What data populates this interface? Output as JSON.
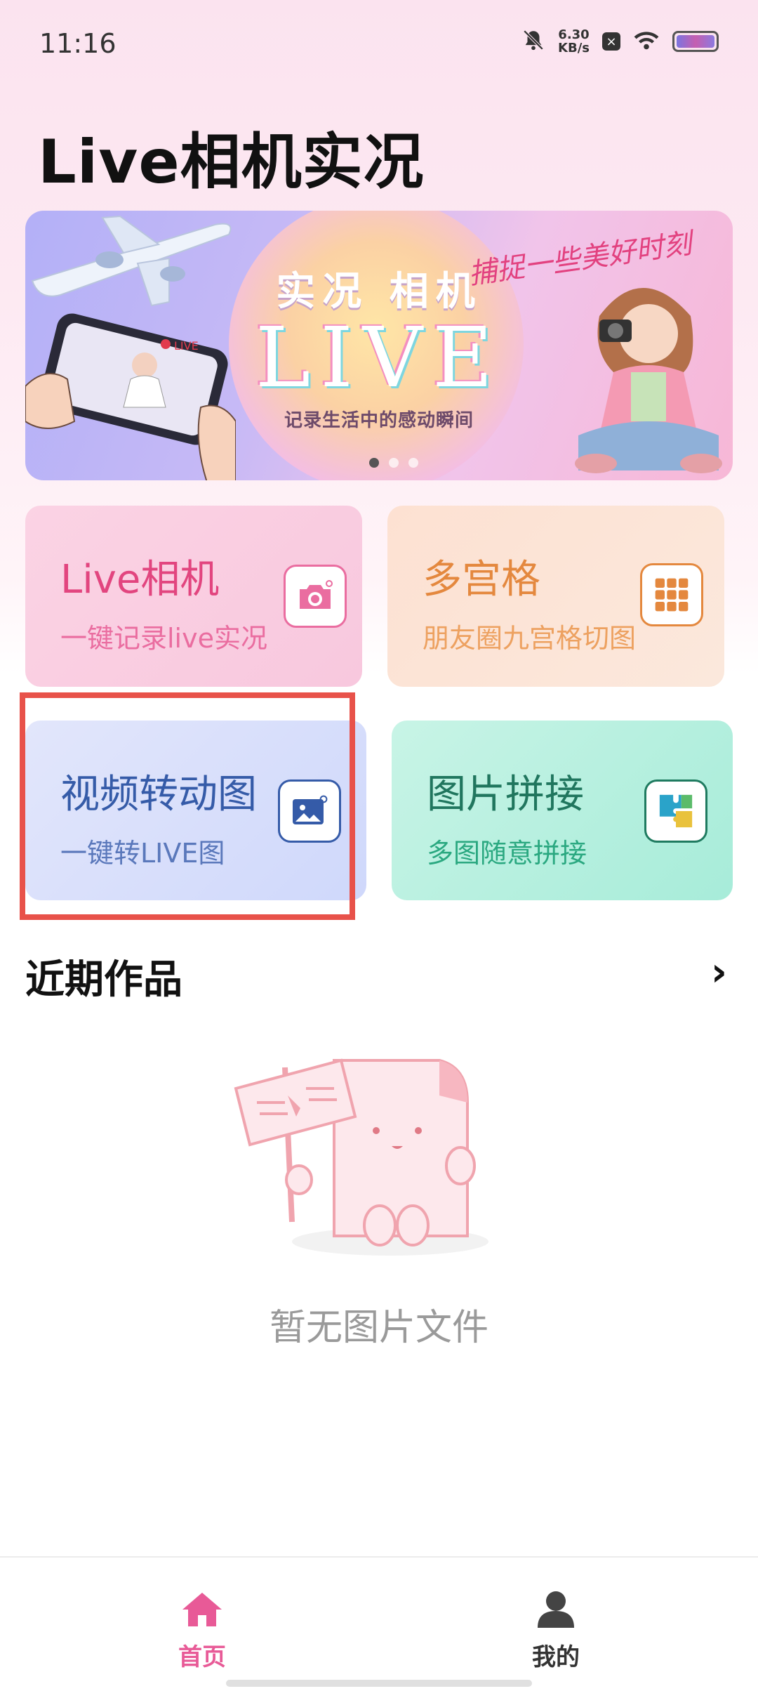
{
  "status_bar": {
    "time": "11:16",
    "net_speed_value": "6.30",
    "net_speed_unit": "KB/s",
    "icons": [
      "mute-bell-icon",
      "close-box-icon",
      "wifi-icon",
      "battery-icon"
    ]
  },
  "header": {
    "title": "Live相机实况"
  },
  "banner": {
    "headline": "实况 相机",
    "big_text": "LIVE",
    "tagline": "记录生活中的感动瞬间",
    "script_text": "捕捉一些美好时刻",
    "slides": 3,
    "active_slide": 1
  },
  "cards": [
    {
      "title": "Live相机",
      "subtitle": "一键记录live实况",
      "icon": "camera-icon",
      "color": "#e2457f"
    },
    {
      "title": "多宫格",
      "subtitle": "朋友圈九宫格切图",
      "icon": "grid-icon",
      "color": "#e4883e"
    },
    {
      "title": "视频转动图",
      "subtitle": "一键转LIVE图",
      "icon": "image-live-icon",
      "color": "#355ba8"
    },
    {
      "title": "图片拼接",
      "subtitle": "多图随意拼接",
      "icon": "puzzle-icon",
      "color": "#20765e"
    }
  ],
  "recent": {
    "title": "近期作品",
    "empty_text": "暂无图片文件"
  },
  "bottom_nav": {
    "items": [
      {
        "label": "首页",
        "icon": "home-icon",
        "active": true
      },
      {
        "label": "我的",
        "icon": "user-icon",
        "active": false
      }
    ]
  },
  "colors": {
    "highlight_box": "#e8524a",
    "nav_active": "#e85a97"
  }
}
